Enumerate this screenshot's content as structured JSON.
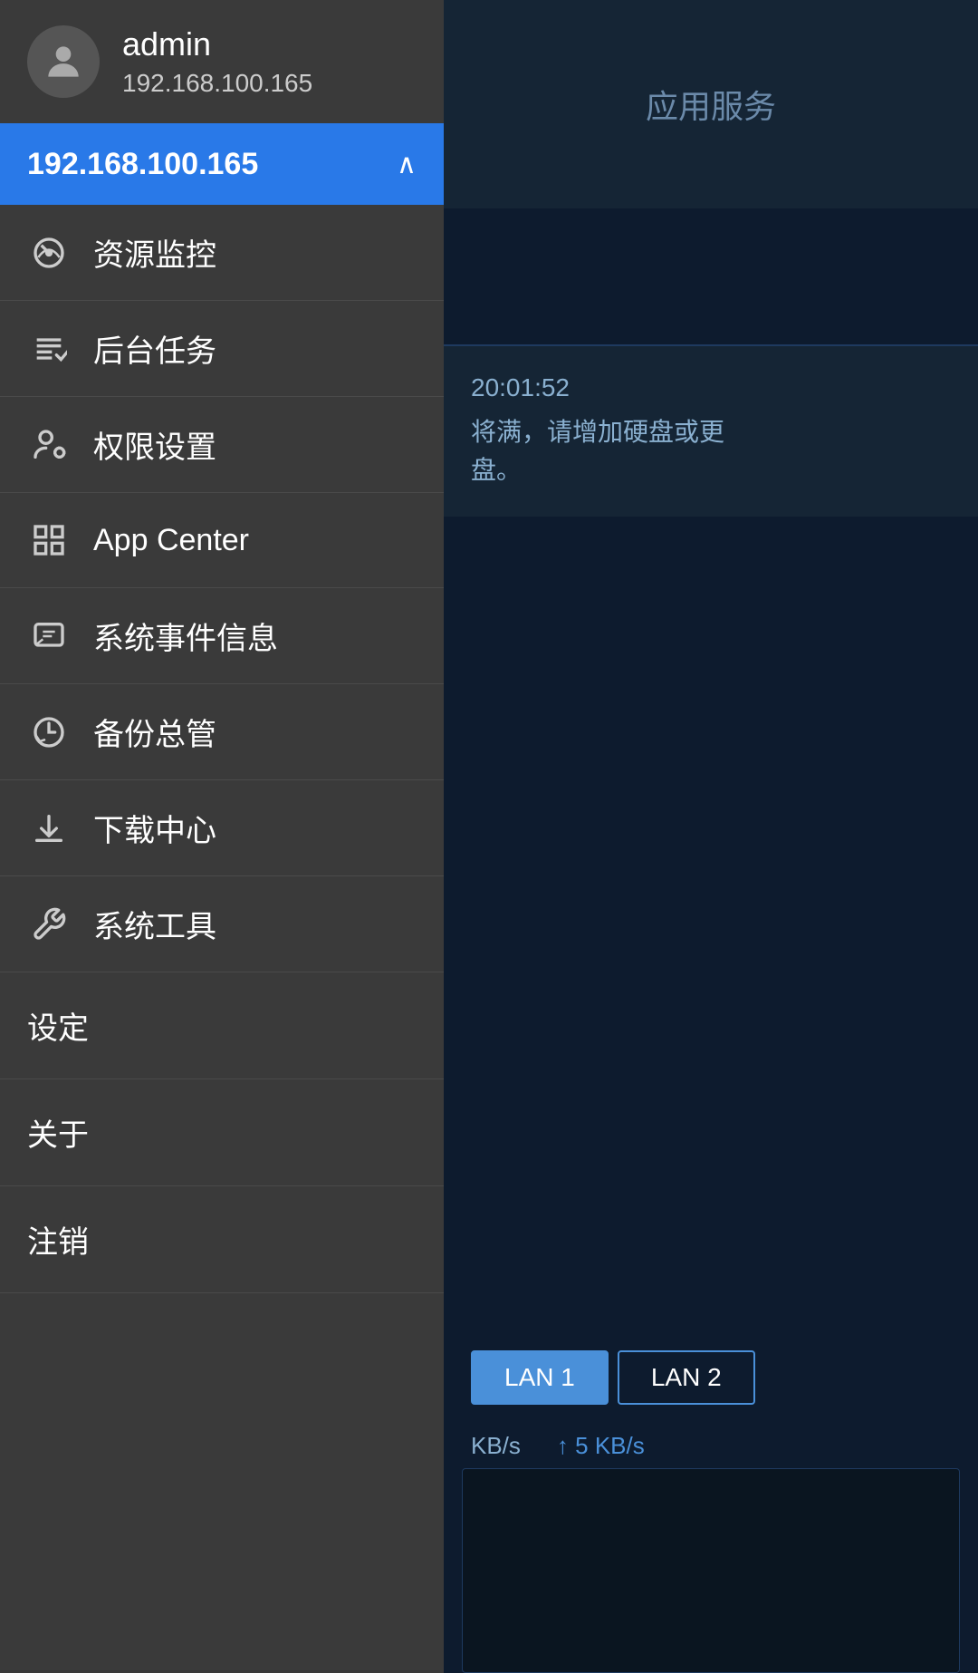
{
  "user": {
    "name": "admin",
    "ip": "192.168.100.165",
    "avatar_icon": "person-icon"
  },
  "active_server": {
    "ip": "192.168.100.165",
    "chevron": "^"
  },
  "background_header": {
    "tab_label": "应用服务"
  },
  "background_notification": {
    "time": "20:01:52",
    "line1": "将满，请增加硬盘或更",
    "line2": "盘。"
  },
  "lan_section": {
    "tab1": "LAN 1",
    "tab2": "LAN 2",
    "speed_down": "KB/s",
    "speed_up": "5 KB/s"
  },
  "menu": {
    "items": [
      {
        "id": "resource-monitor",
        "label": "资源监控",
        "icon": "gauge-icon"
      },
      {
        "id": "background-tasks",
        "label": "后台任务",
        "icon": "tasks-icon"
      },
      {
        "id": "permissions",
        "label": "权限设置",
        "icon": "person-settings-icon"
      },
      {
        "id": "app-center",
        "label": "App Center",
        "icon": "grid-icon"
      },
      {
        "id": "system-events",
        "label": "系统事件信息",
        "icon": "message-icon"
      },
      {
        "id": "backup-manager",
        "label": "备份总管",
        "icon": "backup-icon"
      },
      {
        "id": "download-center",
        "label": "下载中心",
        "icon": "download-icon"
      },
      {
        "id": "system-tools",
        "label": "系统工具",
        "icon": "tools-icon"
      }
    ],
    "simple_items": [
      {
        "id": "settings",
        "label": "设定"
      },
      {
        "id": "about",
        "label": "关于"
      },
      {
        "id": "logout",
        "label": "注销"
      }
    ]
  }
}
